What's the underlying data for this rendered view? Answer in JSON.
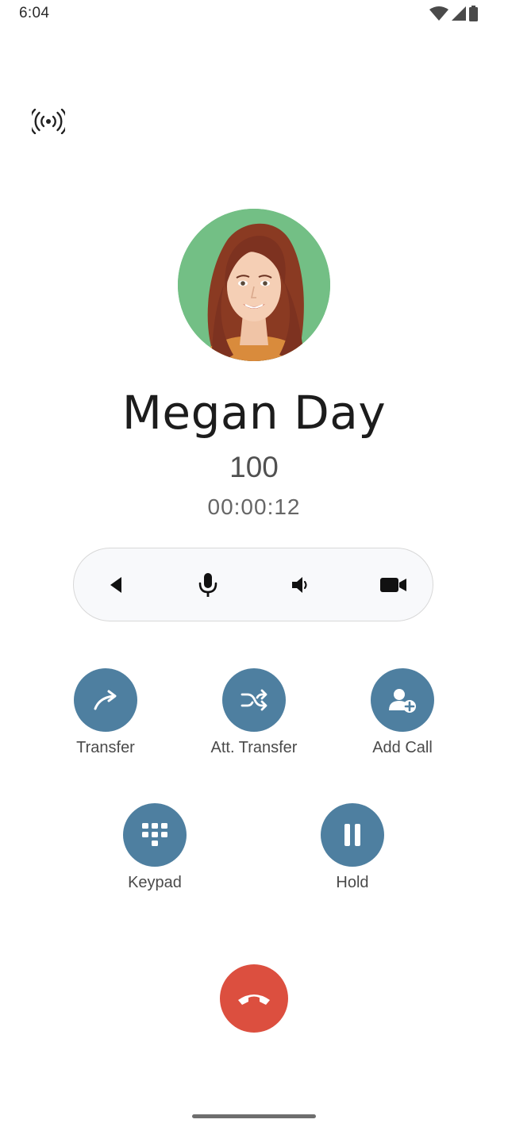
{
  "status_bar": {
    "time": "6:04",
    "icons": [
      "wifi-icon",
      "cell-signal-icon",
      "battery-icon"
    ]
  },
  "header": {
    "icon": "broadcast-icon"
  },
  "caller": {
    "name": "Megan Day",
    "number": "100",
    "duration": "00:00:12"
  },
  "controls": {
    "items": [
      {
        "name": "back",
        "icon": "back-arrow-icon"
      },
      {
        "name": "mute",
        "icon": "microphone-icon"
      },
      {
        "name": "speaker",
        "icon": "speaker-icon"
      },
      {
        "name": "video",
        "icon": "video-camera-icon"
      }
    ]
  },
  "actions": {
    "transfer": {
      "label": "Transfer",
      "icon": "transfer-arrow-icon"
    },
    "att_transfer": {
      "label": "Att. Transfer",
      "icon": "shuffle-icon"
    },
    "add_call": {
      "label": "Add Call",
      "icon": "add-person-icon"
    },
    "keypad": {
      "label": "Keypad",
      "icon": "keypad-icon"
    },
    "hold": {
      "label": "Hold",
      "icon": "pause-icon"
    }
  },
  "end_call": {
    "icon": "hangup-icon"
  },
  "colors": {
    "action_button": "#4e7fa0",
    "hangup": "#dc4f3f",
    "avatar_bg": "#73bf85",
    "pill_bg": "#f8f9fb"
  }
}
